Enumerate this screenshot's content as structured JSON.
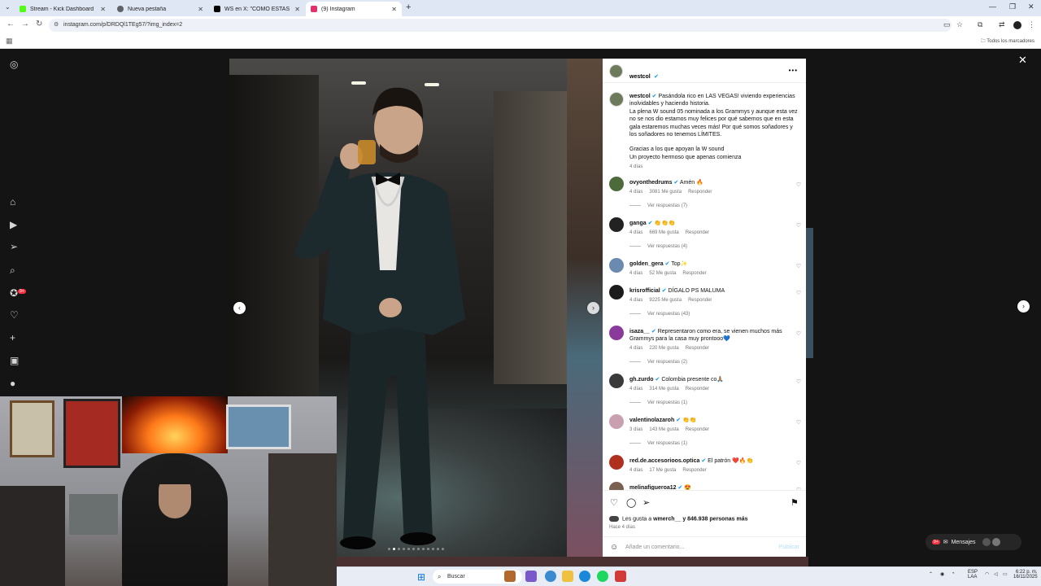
{
  "browser": {
    "tabs": [
      {
        "title": "Stream - Kick Dashboard",
        "favicon_color": "#53fc18"
      },
      {
        "title": "Nueva pestaña",
        "favicon_color": "#5f6368"
      },
      {
        "title": "WS en X: \"COMO ESTAS DOS F",
        "favicon_color": "#000000"
      },
      {
        "title": "(9) Instagram",
        "favicon_color": "#e1306c"
      }
    ],
    "url": "instagram.com/p/DRDQl1TEg57/?img_index=2",
    "bookmarks_label": "Todos los marcadores"
  },
  "post": {
    "username": "westcol",
    "caption_lines": [
      "Pasándola rico en LAS VEGAS! viviendo experiencias inolvidables y haciendo historia.",
      "La plena W sound 05 nominada a los Grammys y aunque esta vez no se nos dio estamos muy felices por qué sabemos que en esta gala estaremos muchas veces más! Por qué somos soñadores y los soñadores no tenemos LÍMITES.",
      "",
      "Gracias a los que apoyan la W sound",
      "Un proyecto hermoso que apenas comienza"
    ],
    "caption_time": "4 días",
    "likes_text": "Les gusta a",
    "likes_user": "wmerch__",
    "likes_rest": "y 846.938 personas más",
    "post_time": "Hace 4 días",
    "comment_placeholder": "Añade un comentario...",
    "publish_label": "Publicar",
    "carousel_count": 12,
    "carousel_active": 1
  },
  "comments": [
    {
      "user": "ovyonthedrums",
      "text": "Amén 🔥",
      "time": "4 días",
      "likes": "3081 Me gusta",
      "reply": "Responder",
      "replies": "Ver respuestas (7)",
      "avatar": "#4b6b3a"
    },
    {
      "user": "ganga",
      "text": "👏👏👏",
      "time": "4 días",
      "likes": "669 Me gusta",
      "reply": "Responder",
      "replies": "Ver respuestas (4)",
      "avatar": "#222222"
    },
    {
      "user": "golden_gera",
      "text": "Top✨",
      "time": "4 días",
      "likes": "52 Me gusta",
      "reply": "Responder",
      "replies": "",
      "avatar": "#6a8ab0"
    },
    {
      "user": "krisrofficial",
      "text": "DÍGALO PS MALUMA",
      "time": "4 días",
      "likes": "9225 Me gusta",
      "reply": "Responder",
      "replies": "Ver respuestas (43)",
      "avatar": "#1b1b1b"
    },
    {
      "user": "isaza__",
      "text": "Representaron como era, se vienen muchos más Grammys para la casa muy prontooo💙",
      "time": "4 días",
      "likes": "220 Me gusta",
      "reply": "Responder",
      "replies": "Ver respuestas (2)",
      "avatar": "#8a3a9a"
    },
    {
      "user": "gh.zurdo",
      "text": "Colombia presente co🙏🏽",
      "time": "4 días",
      "likes": "314 Me gusta",
      "reply": "Responder",
      "replies": "Ver respuestas (1)",
      "avatar": "#3a3a3a"
    },
    {
      "user": "valentinolazaroh",
      "text": "👏👏",
      "time": "3 días",
      "likes": "143 Me gusta",
      "reply": "Responder",
      "replies": "Ver respuestas (1)",
      "avatar": "#c9a0b0"
    },
    {
      "user": "red.de.accesorioos.optica",
      "text": "El patrón ❤️🔥👏",
      "time": "4 días",
      "likes": "17 Me gusta",
      "reply": "Responder",
      "replies": "",
      "avatar": "#b03020"
    },
    {
      "user": "melinafigueroa12",
      "text": "😍",
      "time": "",
      "likes": "",
      "reply": "",
      "replies": "",
      "avatar": "#7a6050"
    }
  ],
  "messages": {
    "label": "Mensajes",
    "badge": "9+"
  },
  "notif_badge": "9+",
  "taskbar": {
    "search_label": "Buscar",
    "lang": "ESP",
    "lang2": "LAA",
    "clock_time": "6:22 p. m.",
    "clock_date": "16/11/2025"
  }
}
